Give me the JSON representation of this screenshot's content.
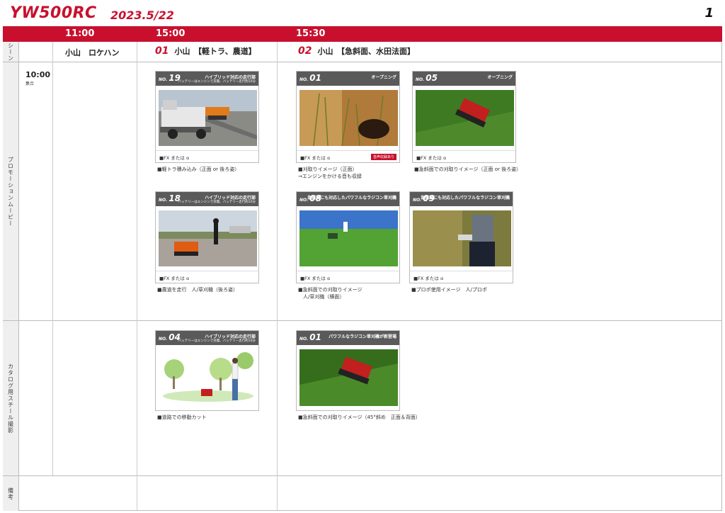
{
  "header": {
    "title": "YW500RC",
    "date": "2023.5/22",
    "page": "1"
  },
  "times": [
    "11:00",
    "15:00",
    "15:30"
  ],
  "row_labels": {
    "scene": "シーン",
    "promo": "プロモーションムービー",
    "catalog": "カタログ用スチール撮影",
    "notes": "備考"
  },
  "scenes": {
    "loc": "小山　ロケハン",
    "s1": {
      "num": "01",
      "label": "小山　【軽トラ、農道】"
    },
    "s2": {
      "num": "02",
      "label": "小山　【急斜面、水田法面】"
    }
  },
  "meeting": {
    "time": "10:00",
    "note": "集合"
  },
  "cards": {
    "c19": {
      "no_prefix": "NO.",
      "no": "19",
      "title": "ハイブリッド対応の走行部",
      "sub": "バッテリーはエンジンで充電、バッテリー走行約10分",
      "tag": "■FX または α",
      "caption": "■軽トラ積み込み（正面 or 後ろ姿）"
    },
    "c18": {
      "no_prefix": "NO.",
      "no": "18",
      "title": "ハイブリッド対応の走行部",
      "sub": "バッテリーはエンジンで充電、バッテリー走行約10分",
      "tag": "■FX または α",
      "caption": "■農道を走行　人/草刈機（後ろ姿）"
    },
    "c01a": {
      "no_prefix": "NO.",
      "no": "01",
      "title": "オープニング",
      "sub": "",
      "tag": "■FX または α",
      "badge": "音声収録あり",
      "caption1": "■刈取りイメージ（正面）",
      "caption2": "→エンジンをかける音も収録"
    },
    "c05": {
      "no_prefix": "NO.",
      "no": "05",
      "title": "オープニング",
      "sub": "",
      "tag": "■FX または α",
      "caption": "■急斜面での刈取りイメージ（正面 or 後ろ姿）"
    },
    "c08": {
      "no_prefix": "NO.",
      "no": "08",
      "title": "急斜面にも対応したパワフルなラジコン草刈機",
      "sub": "",
      "tag": "■FX または α",
      "caption1": "■急斜面での刈取りイメージ",
      "caption2": "　人/草刈機（横面）"
    },
    "c09": {
      "no_prefix": "NO.",
      "no": "09",
      "title": "急斜面にも対応したパワフルなラジコン草刈機",
      "sub": "",
      "tag": "■FX または α",
      "caption": "■プロポ使用イメージ　人/プロポ"
    },
    "c04": {
      "no_prefix": "NO.",
      "no": "04",
      "title": "ハイブリッド対応の走行部",
      "sub": "バッテリーはエンジンで充電、バッテリー走行約10分",
      "caption": "■道路での移動カット"
    },
    "c01b": {
      "no_prefix": "NO.",
      "no": "01",
      "title": "パワフルなラジコン草刈機が新登場",
      "sub": "",
      "caption": "■急斜面での刈取りイメージ（45°斜め　正面＆背面）"
    }
  },
  "colors": {
    "accent": "#c8102e",
    "card_header": "#5a5a5a",
    "row_label_bg": "#efefef"
  }
}
